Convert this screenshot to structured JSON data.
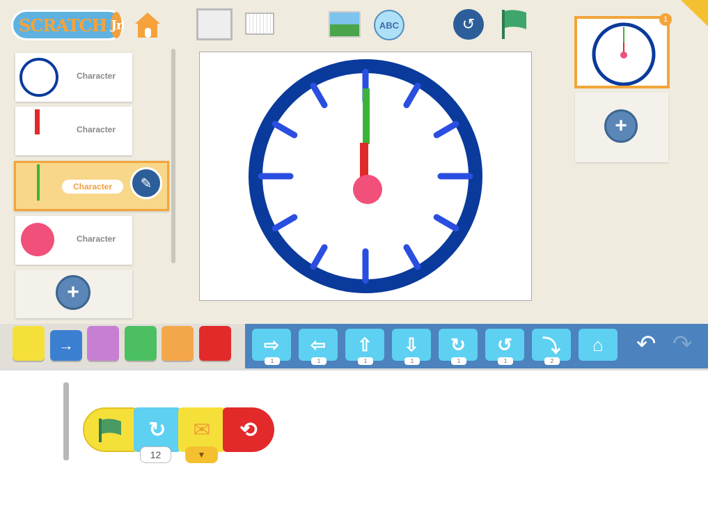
{
  "app": {
    "logo": "ScratchJr",
    "logo_main": "SCRATCH",
    "logo_jr": "Jr"
  },
  "toolbar": {
    "icons": [
      "home-icon",
      "full-screen-icon",
      "grid-icon",
      "background-icon",
      "text-icon",
      "reset-characters-icon",
      "green-flag-icon"
    ]
  },
  "sprites": [
    {
      "label": "Character",
      "image": "clock-face"
    },
    {
      "label": "Character",
      "image": "red-hand"
    },
    {
      "label": "Character",
      "image": "green-hand",
      "selected": true
    },
    {
      "label": "Character",
      "image": "pink-circle"
    }
  ],
  "pages": {
    "count_badge": "1"
  },
  "colors": {
    "accent": "#f2a53b",
    "palette_blue": "#4c82bd",
    "motion_block": "#5ed0f2",
    "clock_ring": "#0a3a9c",
    "tick": "#2a4ee0",
    "center": "#f0507a"
  },
  "categories": [
    "triggering",
    "motion",
    "looks",
    "sound",
    "control",
    "end"
  ],
  "blocks": [
    {
      "icon": "move-right-icon",
      "value": "1"
    },
    {
      "icon": "move-left-icon",
      "value": "1"
    },
    {
      "icon": "move-up-icon",
      "value": "1"
    },
    {
      "icon": "move-down-icon",
      "value": "1"
    },
    {
      "icon": "turn-right-icon",
      "value": "1"
    },
    {
      "icon": "turn-left-icon",
      "value": "1"
    },
    {
      "icon": "hop-icon",
      "value": "2"
    },
    {
      "icon": "go-home-icon"
    }
  ],
  "script": {
    "repeat_value": "12"
  }
}
